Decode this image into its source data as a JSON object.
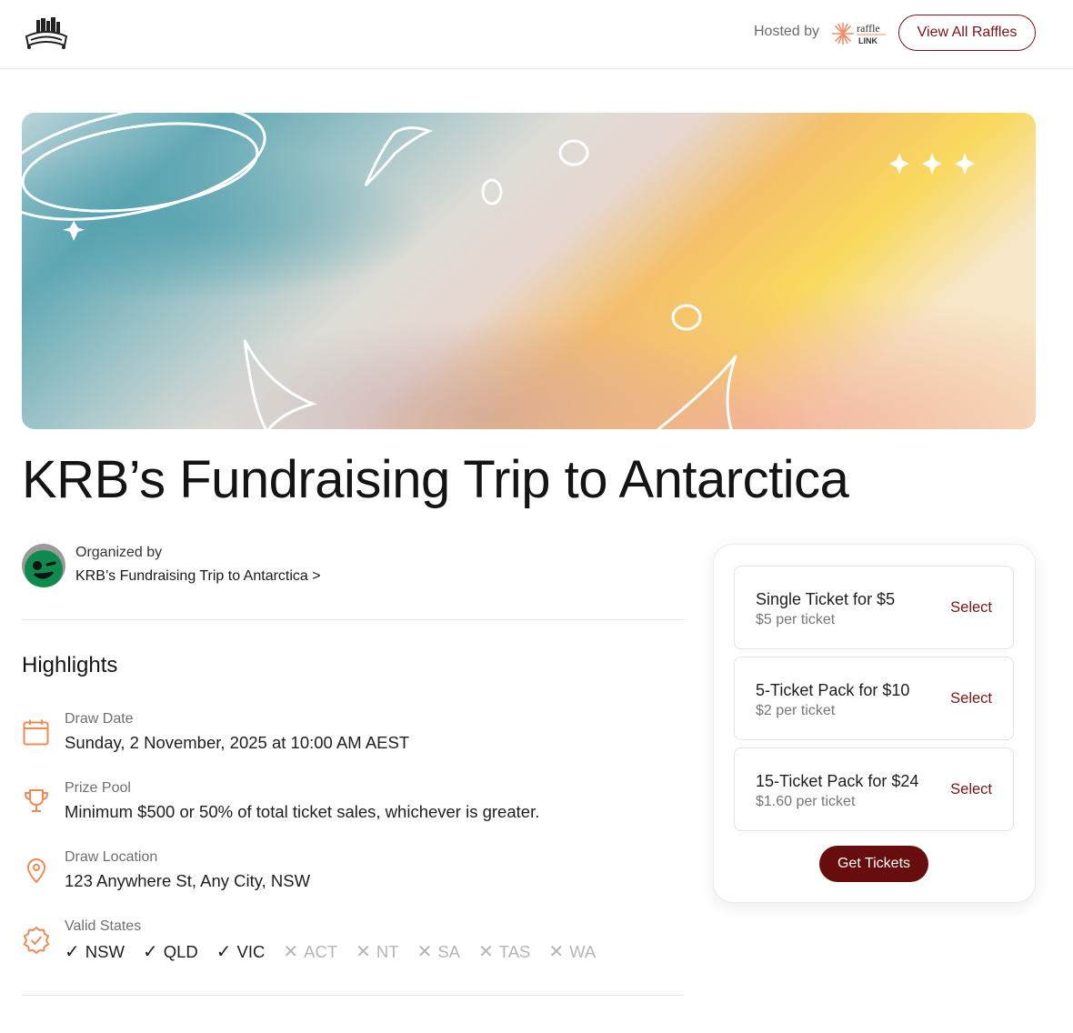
{
  "header": {
    "logo_icon": "organization-logo",
    "hosted_by": "Hosted by",
    "host_logo_icon": "rafflelink-logo",
    "view_all_label": "View All Raffles"
  },
  "banner": {
    "image": "abstract gradient banner with doodles"
  },
  "raffle": {
    "title": "KRB’s Fundraising Trip to Antarctica"
  },
  "organizer": {
    "label": "Organized by",
    "name": "KRB’s Fundraising Trip to Antarctica >"
  },
  "highlights": {
    "heading": "Highlights",
    "draw_date": {
      "label": "Draw Date",
      "value": "Sunday, 2 November, 2025 at 10:00 AM AEST",
      "icon": "calendar-icon"
    },
    "prize_pool": {
      "label": "Prize Pool",
      "value": "Minimum $500 or 50% of total ticket sales, whichever is greater.",
      "icon": "trophy-icon"
    },
    "draw_location": {
      "label": "Draw Location",
      "value": "123 Anywhere St, Any City, NSW",
      "icon": "location-pin-icon"
    },
    "valid_states": {
      "label": "Valid States",
      "icon": "verified-badge-icon",
      "states": [
        {
          "name": "NSW",
          "valid": true
        },
        {
          "name": "QLD",
          "valid": true
        },
        {
          "name": "VIC",
          "valid": true
        },
        {
          "name": "ACT",
          "valid": false
        },
        {
          "name": "NT",
          "valid": false
        },
        {
          "name": "SA",
          "valid": false
        },
        {
          "name": "TAS",
          "valid": false
        },
        {
          "name": "WA",
          "valid": false
        }
      ]
    }
  },
  "tickets": {
    "options": [
      {
        "name": "Single Ticket for $5",
        "per_ticket": "$5 per ticket",
        "select_label": "Select"
      },
      {
        "name": "5-Ticket Pack for $10",
        "per_ticket": "$2 per ticket",
        "select_label": "Select"
      },
      {
        "name": "15-Ticket Pack for $24",
        "per_ticket": "$1.60 per ticket",
        "select_label": "Select"
      }
    ],
    "cta_label": "Get Tickets"
  },
  "colors": {
    "accent": "#7a1414",
    "cta_bg": "#680d0d",
    "icon_orange": "#f08a55",
    "text_primary": "#1e1e1e",
    "text_muted": "#6f6f6f"
  }
}
